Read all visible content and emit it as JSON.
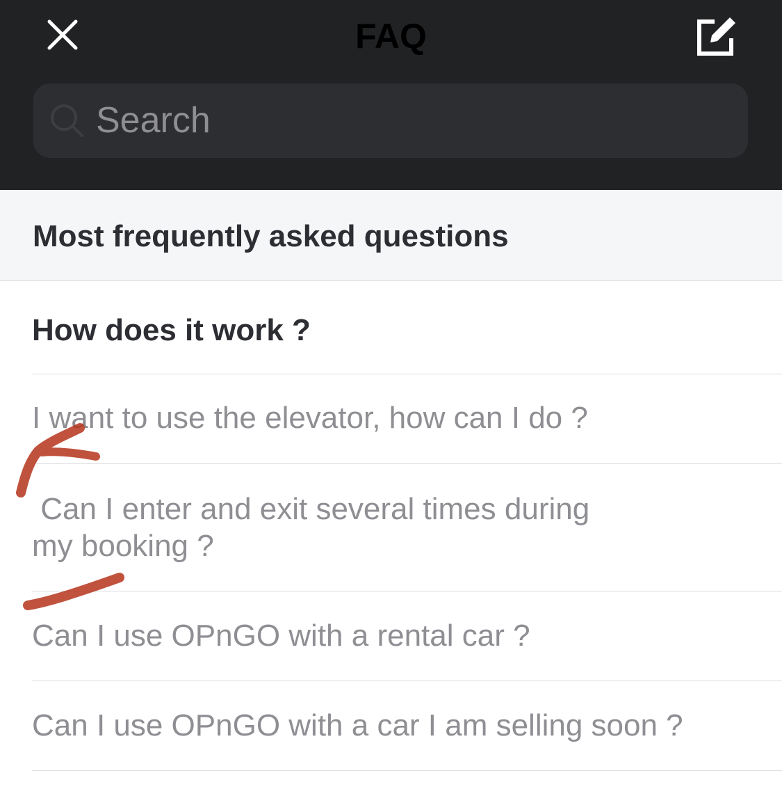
{
  "header": {
    "title": "FAQ",
    "close_icon": "close-icon",
    "compose_icon": "compose-icon",
    "background": "#212224"
  },
  "search": {
    "placeholder": "Search",
    "value": ""
  },
  "section": {
    "title": "Most frequently asked questions"
  },
  "faq_items": [
    {
      "label": "How does it work ?"
    },
    {
      "label": "I want to use the elevator, how can I do ?"
    },
    {
      "line1": " Can I enter and exit several times during",
      "line2": "my booking ?"
    },
    {
      "label": "Can I use OPnGO with a rental car ?"
    },
    {
      "label": "Can I use OPnGO with a car I am selling soon ?"
    }
  ],
  "colors": {
    "question_text": "#8e8e93",
    "heading_text": "#2d2e33",
    "annotation": "#b5341c"
  }
}
